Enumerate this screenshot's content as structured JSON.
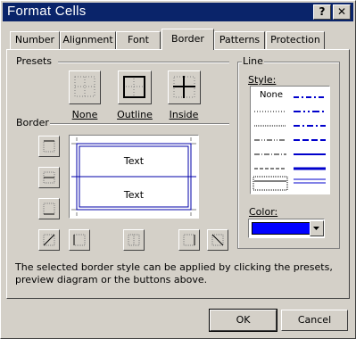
{
  "window": {
    "title": "Format Cells",
    "help_glyph": "?",
    "close_glyph": "✕"
  },
  "tabs": [
    {
      "label": "Number",
      "active": false
    },
    {
      "label": "Alignment",
      "active": false
    },
    {
      "label": "Font",
      "active": false
    },
    {
      "label": "Border",
      "active": true
    },
    {
      "label": "Patterns",
      "active": false
    },
    {
      "label": "Protection",
      "active": false
    }
  ],
  "presets": {
    "group_label": "Presets",
    "none_label": "None",
    "outline_label": "Outline",
    "inside_label": "Inside"
  },
  "border": {
    "group_label": "Border",
    "preview_text_top": "Text",
    "preview_text_bottom": "Text",
    "border_color": "#0000aa"
  },
  "line": {
    "group_label": "Line",
    "style_label": "Style:",
    "style_none_label": "None",
    "color_label": "Color:",
    "selected_color": "#0000ff"
  },
  "hint_text": "The selected border style can be applied by clicking the presets, preview diagram or the buttons above.",
  "buttons": {
    "ok": "OK",
    "cancel": "Cancel"
  }
}
